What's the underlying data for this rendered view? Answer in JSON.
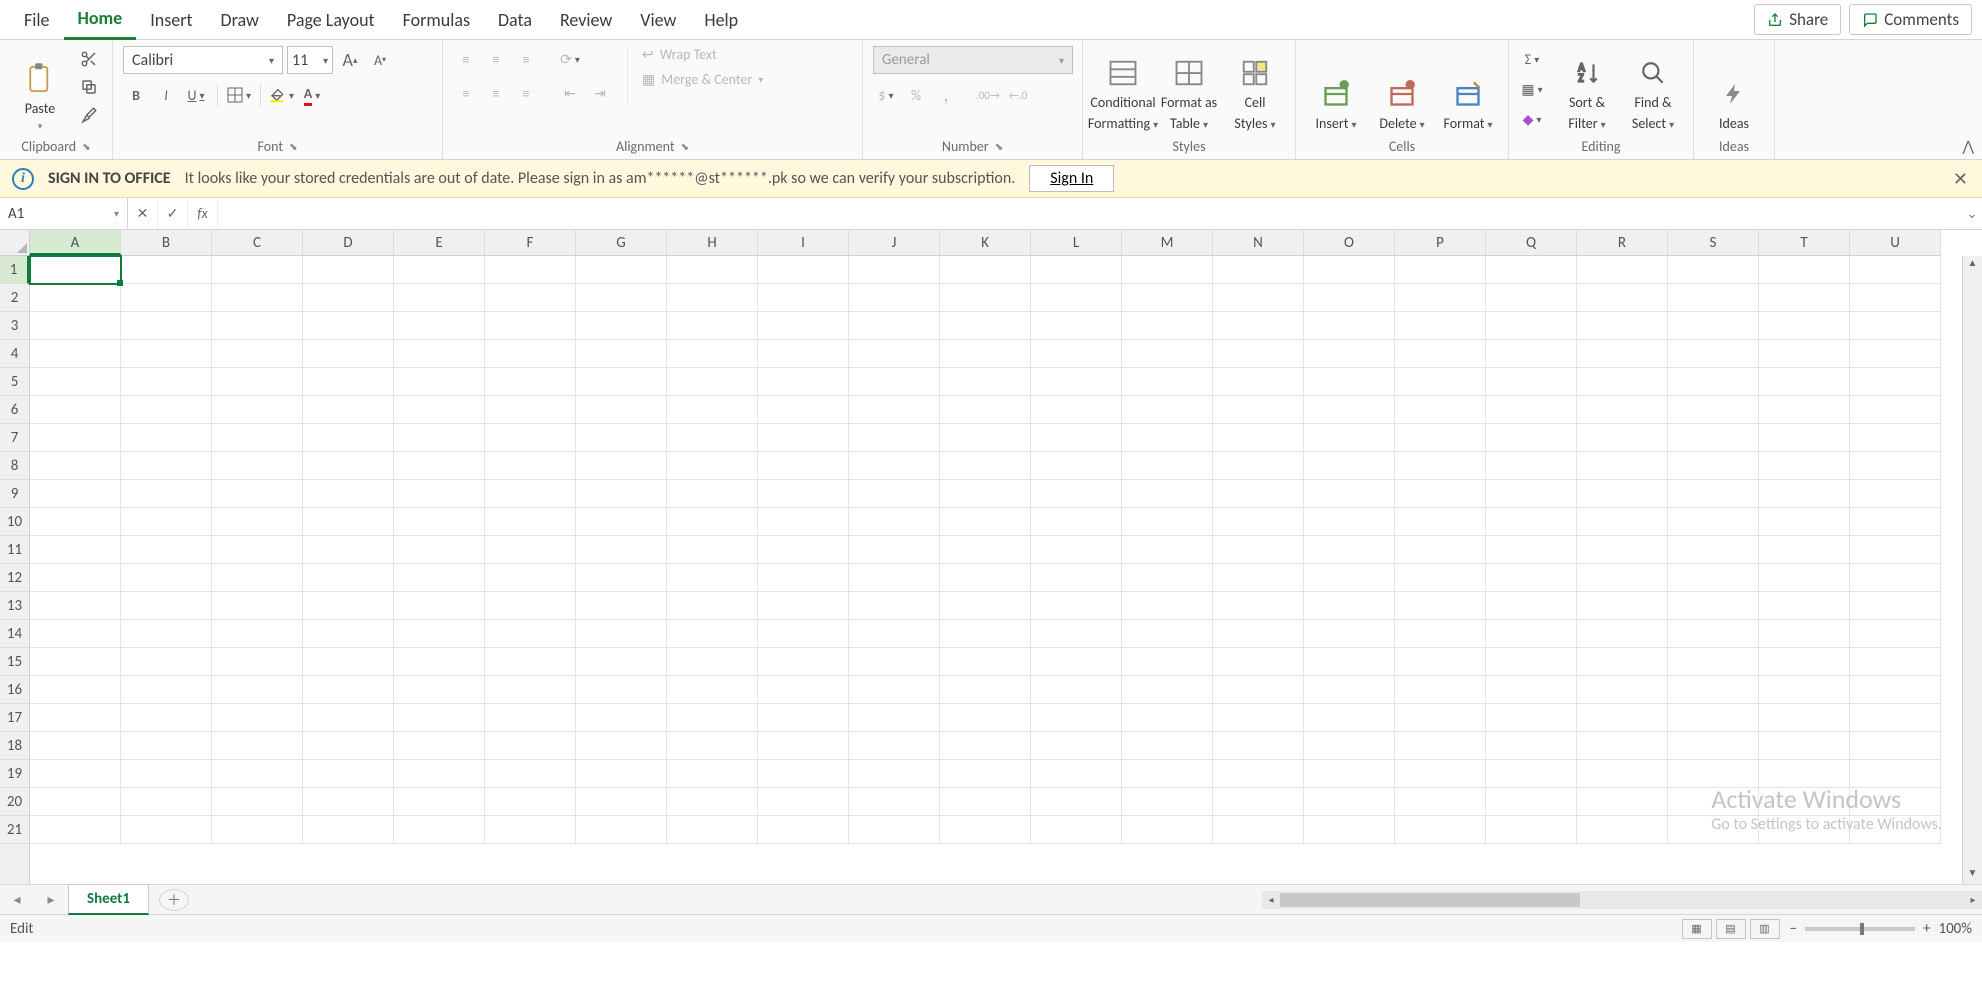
{
  "tabs": {
    "file": "File",
    "home": "Home",
    "insert": "Insert",
    "draw": "Draw",
    "page_layout": "Page Layout",
    "formulas": "Formulas",
    "data": "Data",
    "review": "Review",
    "view": "View",
    "help": "Help",
    "share": "Share",
    "comments": "Comments"
  },
  "ribbon": {
    "clipboard": {
      "paste": "Paste",
      "label": "Clipboard"
    },
    "font": {
      "name": "Calibri",
      "size": "11",
      "bold": "B",
      "italic": "I",
      "underline": "U",
      "label": "Font"
    },
    "alignment": {
      "wrap": "Wrap Text",
      "merge": "Merge & Center",
      "label": "Alignment"
    },
    "number": {
      "format": "General",
      "label": "Number"
    },
    "styles": {
      "cond": "Conditional",
      "cond2": "Formatting",
      "fat": "Format as",
      "fat2": "Table",
      "cell": "Cell",
      "cell2": "Styles",
      "label": "Styles"
    },
    "cells": {
      "insert": "Insert",
      "delete": "Delete",
      "format": "Format",
      "label": "Cells"
    },
    "editing": {
      "sort": "Sort &",
      "sort2": "Filter",
      "find": "Find &",
      "find2": "Select",
      "label": "Editing"
    },
    "ideas": {
      "ideas": "Ideas",
      "label": "Ideas"
    }
  },
  "notification": {
    "title": "SIGN IN TO OFFICE",
    "msg": "It looks like your stored credentials are out of date. Please sign in as am******@st******.pk so we can verify your subscription.",
    "signin": "Sign In"
  },
  "formula": {
    "cellref": "A1",
    "fx": "fx",
    "value": ""
  },
  "columns": [
    "A",
    "B",
    "C",
    "D",
    "E",
    "F",
    "G",
    "H",
    "I",
    "J",
    "K",
    "L",
    "M",
    "N",
    "O",
    "P",
    "Q",
    "R",
    "S",
    "T",
    "U"
  ],
  "rows": [
    "1",
    "2",
    "3",
    "4",
    "5",
    "6",
    "7",
    "8",
    "9",
    "10",
    "11",
    "12",
    "13",
    "14",
    "15",
    "16",
    "17",
    "18",
    "19",
    "20",
    "21"
  ],
  "sheet": {
    "name": "Sheet1"
  },
  "status": {
    "mode": "Edit",
    "zoom": "100%"
  },
  "watermark": {
    "l1": "Activate Windows",
    "l2": "Go to Settings to activate Windows."
  }
}
